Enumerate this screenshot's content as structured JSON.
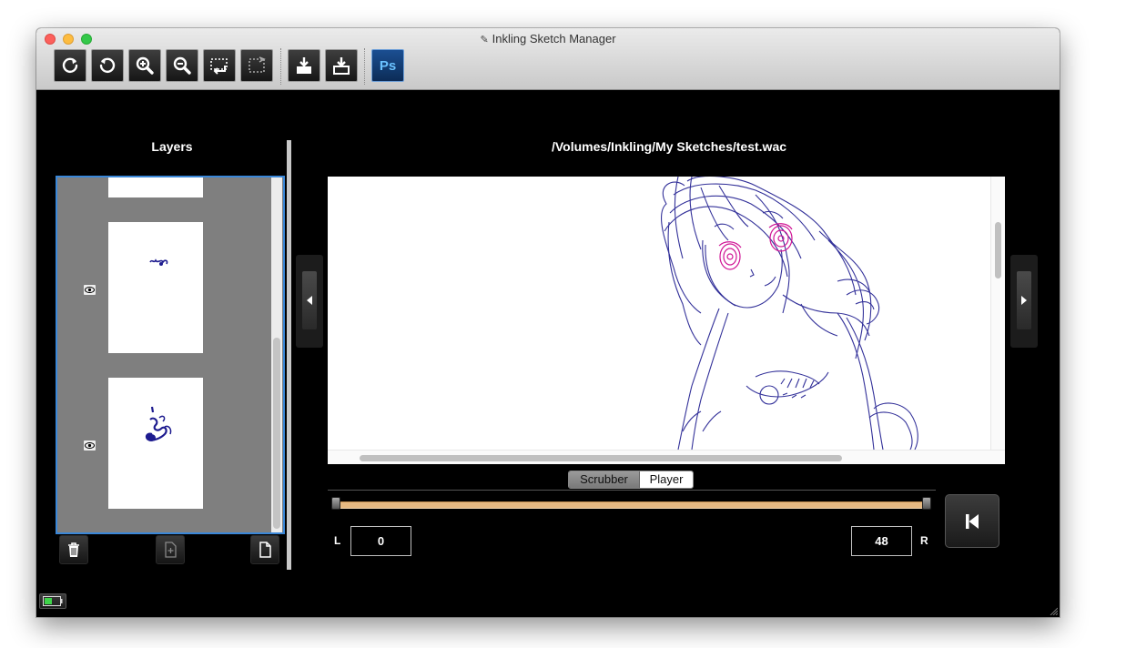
{
  "window": {
    "title": "Inkling Sketch Manager"
  },
  "toolbar": {
    "buttons": [
      {
        "name": "rotate-clockwise",
        "icon": "rotate-cw-icon"
      },
      {
        "name": "rotate-counterclockwise",
        "icon": "rotate-ccw-icon"
      },
      {
        "name": "zoom-in",
        "icon": "zoom-in-icon"
      },
      {
        "name": "zoom-out",
        "icon": "zoom-out-icon"
      },
      {
        "name": "fit-selection",
        "icon": "fit-selection-icon"
      },
      {
        "name": "actual-size",
        "icon": "actual-size-icon"
      },
      {
        "name": "export-image",
        "icon": "export-icon"
      },
      {
        "name": "export-file",
        "icon": "export-file-icon"
      },
      {
        "name": "photoshop",
        "icon": "photoshop-icon",
        "label": "Ps"
      }
    ]
  },
  "layers": {
    "title": "Layers",
    "items": [
      {
        "visible": true,
        "icon": "eye-icon"
      },
      {
        "visible": true,
        "icon": "eye-icon"
      }
    ],
    "buttons": [
      {
        "name": "delete-layer",
        "icon": "trash-icon"
      },
      {
        "name": "new-layer",
        "icon": "add-page-icon"
      },
      {
        "name": "duplicate-layer",
        "icon": "page-icon"
      }
    ]
  },
  "document": {
    "path": "/Volumes/Inkling/My Sketches/test.wac"
  },
  "playback": {
    "modes": [
      "Scrubber",
      "Player"
    ],
    "active_mode": "Scrubber",
    "left_label": "L",
    "right_label": "R",
    "left_value": "0",
    "right_value": "48"
  },
  "colors": {
    "window_bg": "#000000",
    "selection_border": "#3a87d8",
    "slider_track": "#e6b982",
    "ink": "#1d1b8f",
    "accent_ink": "#d01595",
    "photoshop_blue": "#1b4f92"
  }
}
